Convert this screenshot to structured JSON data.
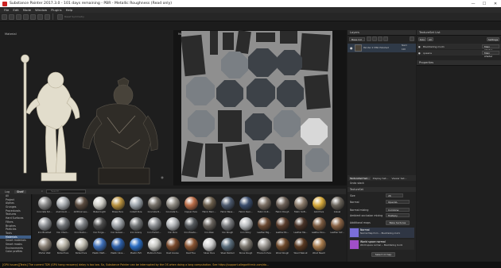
{
  "window": {
    "title": "Substance Painter 2017.3.0 - 101 days remaining - PBR - Metallic Roughness (Read only)",
    "minimize": "—",
    "maximize": "☐",
    "close": "✕"
  },
  "menu": [
    "File",
    "Edit",
    "Mode",
    "Window",
    "Plugins",
    "Help"
  ],
  "toolbar": {
    "symmetry_label": "Reset Symmetry"
  },
  "viewports": {
    "left_label": "Material",
    "right_label": "Material"
  },
  "layers": {
    "title": "Layers",
    "blend_mode": "Base Col",
    "layer_name": "Painter 2 MSK Polished",
    "layer_blend": "Norm",
    "layer_opacity": "100"
  },
  "texture_set_list": {
    "title": "TextureSet List",
    "solo_label": "Solo",
    "all_label": "All",
    "settings_label": "Settings",
    "items": [
      {
        "name": "Blacktailing mod1",
        "shader": "Main shader"
      },
      {
        "name": "queens",
        "shader": "Main shader"
      }
    ]
  },
  "properties": {
    "title": "Properties"
  },
  "shelf": {
    "tabs": [
      "Log",
      "Shelf"
    ],
    "active_tab": "Shelf",
    "search_placeholder": "Search...",
    "categories": [
      "All",
      "Project",
      "Alphas",
      "Grunges",
      "Procedurals",
      "Textures",
      "Hard Surfaces",
      "Filters",
      "Brushes",
      "Particles",
      "Tools",
      "Materials",
      "Smart materials",
      "Smart masks",
      "Environments",
      "Color profiles"
    ],
    "selected_category": "Materials",
    "materials": [
      {
        "name": "Concrete Sm...",
        "color": "#8a8a8a"
      },
      {
        "name": "Aluminium ...",
        "color": "#a8acb0"
      },
      {
        "name": "Artificial Lea...",
        "color": "#5a4b3f"
      },
      {
        "name": "Baked Light",
        "color": "#d0cfc8"
      },
      {
        "name": "Brass Pure",
        "color": "#b8913f"
      },
      {
        "name": "Cobalt Pure",
        "color": "#9ea6ad"
      },
      {
        "name": "Concrete B...",
        "color": "#757068"
      },
      {
        "name": "Concrete S...",
        "color": "#8f8b83"
      },
      {
        "name": "Copper Pure",
        "color": "#b96d48"
      },
      {
        "name": "Fabric Barn...",
        "color": "#6a5d4b"
      },
      {
        "name": "Fabric Base...",
        "color": "#4d5a6e"
      },
      {
        "name": "Fabric Deni...",
        "color": "#3b4d6d"
      },
      {
        "name": "Fabric Knit...",
        "color": "#7a6e63"
      },
      {
        "name": "Fabric Rough",
        "color": "#6d6158"
      },
      {
        "name": "Fabric Soft...",
        "color": "#8b7b6b"
      },
      {
        "name": "Gold Pure",
        "color": "#d6a93c"
      },
      {
        "name": "Gravel",
        "color": "#6b655c"
      },
      {
        "name": "Iron Brushed",
        "color": "#8e9195"
      },
      {
        "name": "Iron Chain...",
        "color": "#6f7276"
      },
      {
        "name": "Iron Diamo...",
        "color": "#7e8185"
      },
      {
        "name": "Iron Forge...",
        "color": "#4c4c4c"
      },
      {
        "name": "Iron Galvan...",
        "color": "#9ca1a6"
      },
      {
        "name": "Iron Grainy",
        "color": "#747779"
      },
      {
        "name": "Iron Hamm...",
        "color": "#8b8e92"
      },
      {
        "name": "Iron Pure",
        "color": "#b0b3b6"
      },
      {
        "name": "Iron Powde...",
        "color": "#55595d"
      },
      {
        "name": "Iron Raw",
        "color": "#66615b"
      },
      {
        "name": "Iron Rough",
        "color": "#797b7e"
      },
      {
        "name": "Iron Shiny",
        "color": "#b9bcbf"
      },
      {
        "name": "Leather Big...",
        "color": "#6b4a33"
      },
      {
        "name": "Leather Bo...",
        "color": "#5a3d2c"
      },
      {
        "name": "Leather Ma...",
        "color": "#4a3428"
      },
      {
        "name": "Leather Rou...",
        "color": "#7a5a40"
      },
      {
        "name": "Leather Sof...",
        "color": "#8a6446"
      },
      {
        "name": "Mortar Wall",
        "color": "#8c8378"
      },
      {
        "name": "Nickel Pure",
        "color": "#b7b2a5"
      },
      {
        "name": "Nickel Pure",
        "color": "#c1bdb1"
      },
      {
        "name": "Plastic Matt...",
        "color": "#3e6fb8"
      },
      {
        "name": "Plastic Glos...",
        "color": "#2d5fa8"
      },
      {
        "name": "Plastic PVC",
        "color": "#2b6dc2"
      },
      {
        "name": "Platinum Pure",
        "color": "#c7c7c2"
      },
      {
        "name": "Rust Coarse",
        "color": "#7a4a2c"
      },
      {
        "name": "Rust Fine",
        "color": "#8a5533"
      },
      {
        "name": "Silver Pure",
        "color": "#d0d0d0"
      },
      {
        "name": "Steel Painted",
        "color": "#5b6e7d"
      },
      {
        "name": "Stone Rough",
        "color": "#7d7870"
      },
      {
        "name": "Titanium Pure",
        "color": "#9e9a94"
      },
      {
        "name": "Wood Rough",
        "color": "#6e4a2c"
      },
      {
        "name": "Wood Walnut",
        "color": "#5a3a22"
      },
      {
        "name": "Wood Beech",
        "color": "#a67a4c"
      }
    ]
  },
  "texture_settings": {
    "tabs": [
      "TextureSet Set...",
      "Display Set...",
      "Viewer Set..."
    ],
    "active_tab": "TextureSet Set...",
    "undo_label": "Undo stack",
    "section": "TextureSet",
    "size_label": "Size",
    "size_value": "2K",
    "normal_label": "Normal",
    "normal_value": "OpenGL",
    "normal_mixing_label": "Normal mixing",
    "normal_mixing_value": "Combine",
    "ao_mixing_label": "Ambient occlusion mixing",
    "ao_mixing_value": "Multiply",
    "additional_maps_label": "Additional maps",
    "bake_label": "Bake textures",
    "maps": [
      {
        "name": "Normal",
        "sub": "Normal Map from ... Blacktailing mod1"
      },
      {
        "name": "World space normal",
        "sub": "World space normal ... Blacktailing mod1"
      }
    ],
    "select_map_label": "Select id map"
  },
  "status_bar": {
    "text": "[GPU Issues][Texts] The current TDR (GPU hang recovery) delay is too low. So, Substance Painter can be interrupted by the OS when doing a long computation. See https://support.allegorithmic.com/do..."
  }
}
